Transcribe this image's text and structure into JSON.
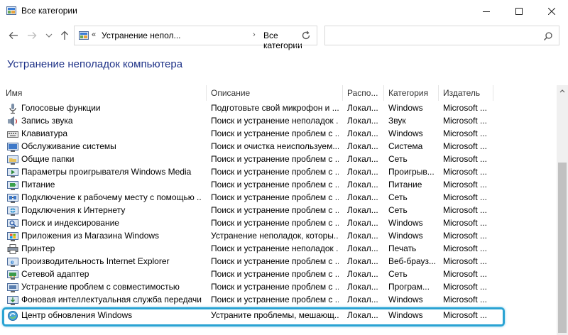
{
  "window": {
    "title": "Все категории"
  },
  "navigation": {
    "crumb_prefix": "«",
    "breadcrumbs": [
      "Устранение непол...",
      "Все категории"
    ],
    "breadcrumb_separator": "›",
    "search_placeholder": ""
  },
  "page": {
    "heading": "Устранение неполадок компьютера"
  },
  "table": {
    "columns": [
      "Имя",
      "Описание",
      "Распо...",
      "Категория",
      "Издатель"
    ],
    "rows": [
      {
        "name": "Голосовые функции",
        "description": "Подготовьте свой микрофон и ...",
        "location": "Локал...",
        "category": "Windows",
        "publisher": "Microsoft ...",
        "icon": "microphone-icon"
      },
      {
        "name": "Запись звука",
        "description": "Поиск и устранение неполадок ...",
        "location": "Локал...",
        "category": "Звук",
        "publisher": "Microsoft ...",
        "icon": "sound-recording-icon"
      },
      {
        "name": "Клавиатура",
        "description": "Поиск и устранение проблем с ...",
        "location": "Локал...",
        "category": "Windows",
        "publisher": "Microsoft ...",
        "icon": "keyboard-icon"
      },
      {
        "name": "Обслуживание системы",
        "description": "Поиск и очистка неиспользуем...",
        "location": "Локал...",
        "category": "Система",
        "publisher": "Microsoft ...",
        "icon": "system-maintenance-icon"
      },
      {
        "name": "Общие папки",
        "description": "Поиск и устранение проблем с ...",
        "location": "Локал...",
        "category": "Сеть",
        "publisher": "Microsoft ...",
        "icon": "shared-folders-icon"
      },
      {
        "name": "Параметры проигрывателя Windows Media",
        "description": "Поиск и устранение проблем с ...",
        "location": "Локал...",
        "category": "Проигрыв...",
        "publisher": "Microsoft ...",
        "icon": "media-player-icon"
      },
      {
        "name": "Питание",
        "description": "Поиск и устранение проблем с ...",
        "location": "Локал...",
        "category": "Питание",
        "publisher": "Microsoft ...",
        "icon": "power-icon"
      },
      {
        "name": "Подключение к рабочему месту с помощью ...",
        "description": "Поиск и устранение проблем с ...",
        "location": "Локал...",
        "category": "Сеть",
        "publisher": "Microsoft ...",
        "icon": "workplace-connection-icon"
      },
      {
        "name": "Подключения к Интернету",
        "description": "Поиск и устранение проблем с ...",
        "location": "Локал...",
        "category": "Сеть",
        "publisher": "Microsoft ...",
        "icon": "internet-connection-icon"
      },
      {
        "name": "Поиск и индексирование",
        "description": "Поиск и устранение проблем с ...",
        "location": "Локал...",
        "category": "Windows",
        "publisher": "Microsoft ...",
        "icon": "search-indexing-icon"
      },
      {
        "name": "Приложения из Магазина Windows",
        "description": "Устранение неполадок, которы...",
        "location": "Локал...",
        "category": "Windows",
        "publisher": "Microsoft ...",
        "icon": "store-apps-icon"
      },
      {
        "name": "Принтер",
        "description": "Поиск и устранение неполадок ...",
        "location": "Локал...",
        "category": "Печать",
        "publisher": "Microsoft ...",
        "icon": "printer-icon"
      },
      {
        "name": "Производительность Internet Explorer",
        "description": "Поиск и устранение проблем с ...",
        "location": "Локал...",
        "category": "Веб-брауз...",
        "publisher": "Microsoft ...",
        "icon": "internet-explorer-icon"
      },
      {
        "name": "Сетевой адаптер",
        "description": "Поиск и устранение проблем с ...",
        "location": "Локал...",
        "category": "Сеть",
        "publisher": "Microsoft ...",
        "icon": "network-adapter-icon"
      },
      {
        "name": "Устранение проблем с совместимостью",
        "description": "Поиск и устранение проблем с ...",
        "location": "Локал...",
        "category": "Програм...",
        "publisher": "Microsoft ...",
        "icon": "compatibility-icon"
      },
      {
        "name": "Фоновая интеллектуальная служба передачи (...",
        "description": "Поиск и устранение проблем с ...",
        "location": "Локал...",
        "category": "Windows",
        "publisher": "Microsoft ...",
        "icon": "bits-icon"
      },
      {
        "name": "Центр обновления Windows",
        "description": "Устраните проблемы, мешающ...",
        "location": "Локал...",
        "category": "Windows",
        "publisher": "Microsoft ...",
        "icon": "windows-update-icon"
      }
    ]
  },
  "colors": {
    "heading": "#1e3287",
    "highlight_border": "#2aa3d3"
  }
}
